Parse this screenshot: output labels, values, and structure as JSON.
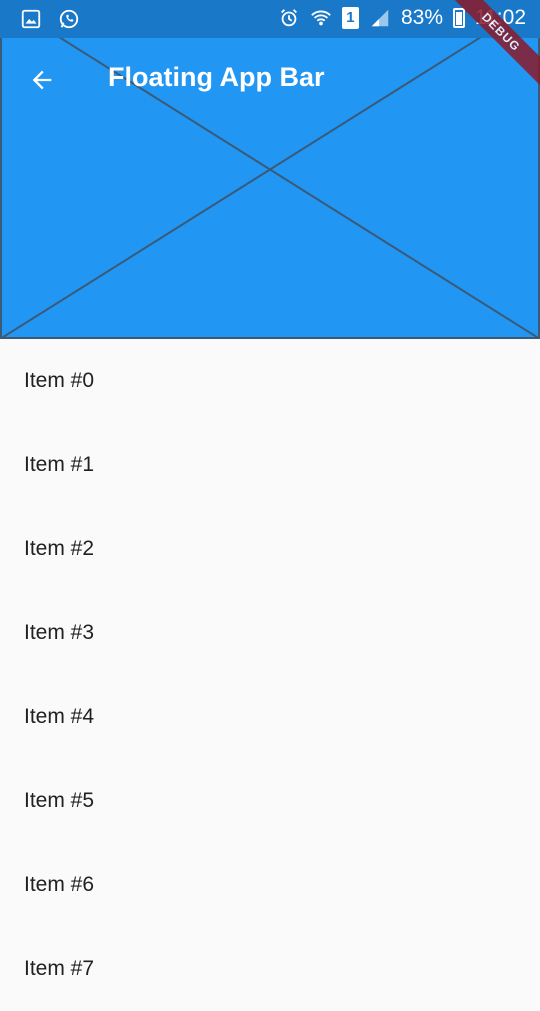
{
  "status_bar": {
    "battery_percent": "83%",
    "time": "11:02",
    "sim_slot": "1",
    "icons": [
      "gallery-icon",
      "whatsapp-icon",
      "alarm-icon",
      "wifi-icon",
      "sim-icon",
      "signal-icon",
      "battery-icon"
    ]
  },
  "app_bar": {
    "title": "Floating App Bar",
    "back_icon": "arrow-back-icon",
    "background": "#2196f3"
  },
  "debug_banner": "DEBUG",
  "list": {
    "items": [
      "Item #0",
      "Item #1",
      "Item #2",
      "Item #3",
      "Item #4",
      "Item #5",
      "Item #6",
      "Item #7"
    ]
  }
}
